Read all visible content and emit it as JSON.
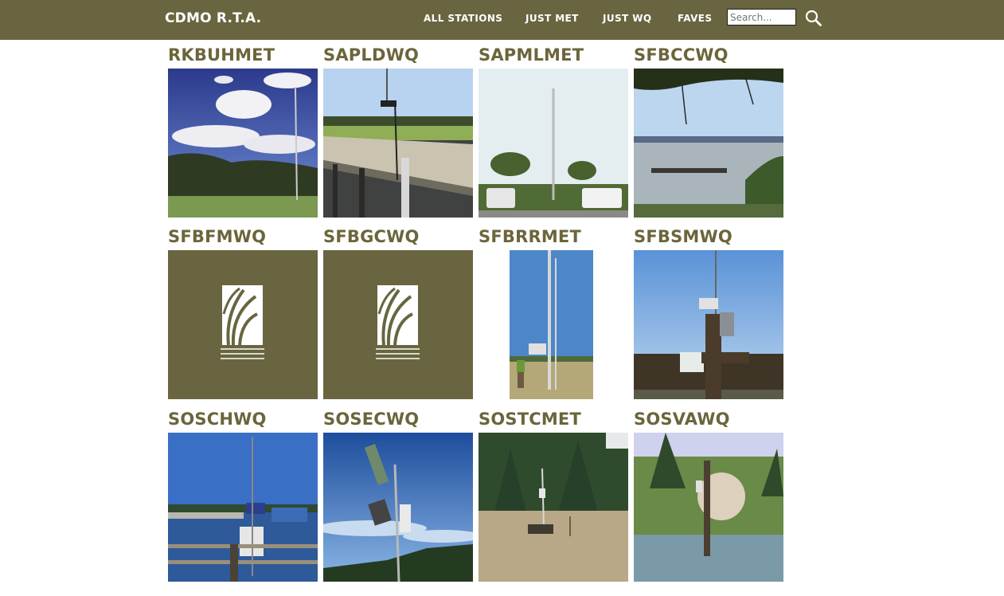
{
  "header": {
    "brand": "CDMO R.T.A.",
    "nav": [
      {
        "label": "ALL STATIONS"
      },
      {
        "label": "JUST MET"
      },
      {
        "label": "JUST WQ"
      },
      {
        "label": "FAVES"
      }
    ],
    "search": {
      "placeholder": "Search...",
      "value": ""
    },
    "search_icon": "magnifier-icon",
    "bar_color": "#686540"
  },
  "stations": [
    {
      "code": "RKBUHMET",
      "image": "tower-cloudy-sky"
    },
    {
      "code": "SAPLDWQ",
      "image": "boardwalk-pier"
    },
    {
      "code": "SAPMLMET",
      "image": "tower-with-trucks"
    },
    {
      "code": "SFBCCWQ",
      "image": "bay-with-pier"
    },
    {
      "code": "SFBFMWQ",
      "image": "reserve-logo-placeholder"
    },
    {
      "code": "SFBGCWQ",
      "image": "reserve-logo-placeholder"
    },
    {
      "code": "SFBRRMET",
      "image": "tall-tower-field"
    },
    {
      "code": "SFBSMWQ",
      "image": "marsh-post-station"
    },
    {
      "code": "SOSCHWQ",
      "image": "dock-station"
    },
    {
      "code": "SOSECWQ",
      "image": "sensor-pole-blue-sky"
    },
    {
      "code": "SOSTCMET",
      "image": "field-tower-forest"
    },
    {
      "code": "SOSVAWQ",
      "image": "piling-in-water"
    }
  ],
  "colors": {
    "title": "#6b653b",
    "logo_bg": "#686540"
  }
}
